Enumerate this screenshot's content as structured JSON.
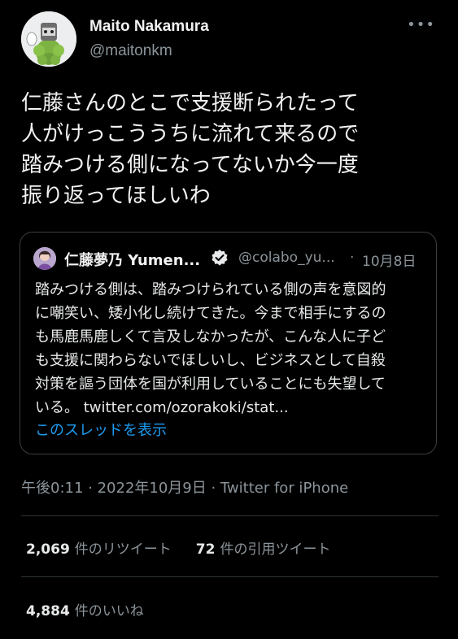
{
  "author": {
    "name": "Maito Nakamura",
    "handle": "@maitonkm",
    "more_icon": "more-icon"
  },
  "tweet": {
    "text": "仁藤さんのとこで支援断られたって\n人がけっこううちに流れて来るので\n踏みつける側になってないか今一度\n振り返ってほしいわ"
  },
  "quote": {
    "name": "仁藤夢乃 Yumen...",
    "handle": "@colabo_yu...",
    "separator": "·",
    "date": "10月8日",
    "body": "踏みつける側は、踏みつけられている側の声を意図的\nに嘲笑い、矮小化し続けてきた。今まで相手にするの\nも馬鹿馬鹿しくて言及しなかったが、こんな人に子ど\nも支援に関わらないでほしいし、ビジネスとして自殺\n対策を謳う団体を国が利用していることにも失望して\nいる。",
    "link": "twitter.com/ozorakoki/stat...",
    "show_thread": "このスレッドを表示",
    "verified_icon": "verified-badge-icon"
  },
  "meta": {
    "time_line": "午後0:11 · 2022年10月9日 · Twitter for iPhone"
  },
  "stats": {
    "retweets_count": "2,069",
    "retweets_label": "件のリツイート",
    "quotes_count": "72",
    "quotes_label": "件の引用ツイート",
    "likes_count": "4,884",
    "likes_label": "件のいいね"
  },
  "colors": {
    "background": "#000000",
    "text": "#e7e9ea",
    "secondary": "#8b949a",
    "link": "#1d9bf0",
    "border": "#3a3f44"
  }
}
